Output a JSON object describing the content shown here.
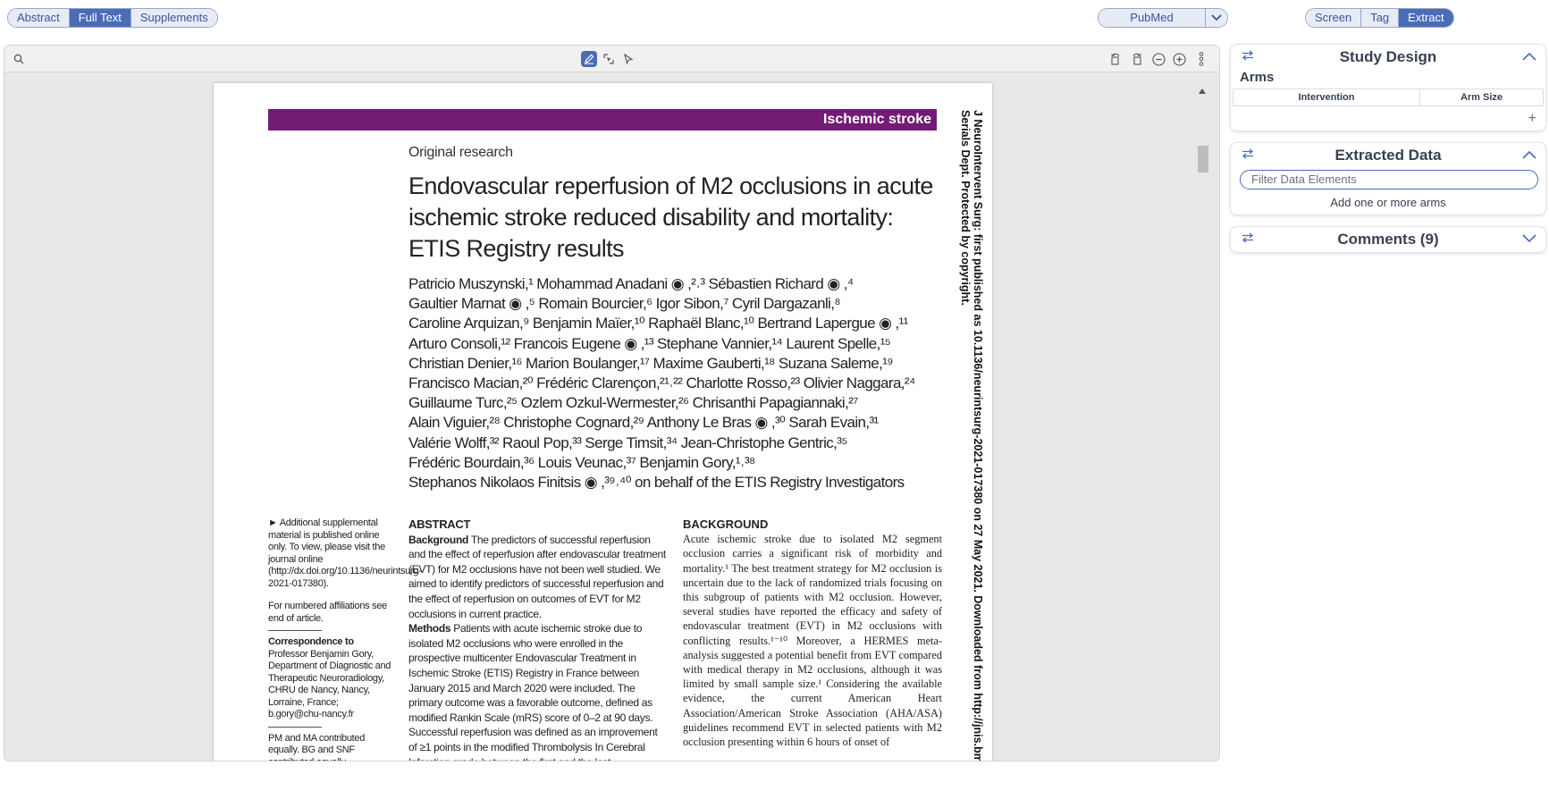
{
  "top_tabs": [
    "Abstract",
    "Full Text",
    "Supplements"
  ],
  "top_tabs_active": "Full Text",
  "pubmed": {
    "label": "PubMed"
  },
  "mode_tabs": [
    "Screen",
    "Tag",
    "Extract"
  ],
  "mode_tabs_active": "Extract",
  "document": {
    "banner": "Ischemic stroke",
    "section": "Original research",
    "title": "Endovascular reperfusion of M2 occlusions in acute ischemic stroke reduced disability and mortality: ETIS Registry results",
    "authors": [
      "Patricio Muszynski,¹ Mohammad Anadani ◉ ,²˒³ Sébastien Richard ◉ ,⁴",
      "Gaultier Marnat ◉ ,⁵ Romain Bourcier,⁶ Igor Sibon,⁷ Cyril Dargazanli,⁸",
      "Caroline Arquizan,⁹ Benjamin Maïer,¹⁰ Raphaël Blanc,¹⁰ Bertrand Lapergue ◉ ,¹¹",
      "Arturo Consoli,¹² Francois Eugene ◉ ,¹³ Stephane Vannier,¹⁴ Laurent Spelle,¹⁵",
      "Christian Denier,¹⁶ Marion Boulanger,¹⁷ Maxime Gauberti,¹⁸ Suzana Saleme,¹⁹",
      "Francisco Macian,²⁰ Frédéric Clarençon,²¹˒²² Charlotte Rosso,²³ Olivier Naggara,²⁴",
      "Guillaume Turc,²⁵ Ozlem Ozkul-Wermester,²⁶ Chrisanthi Papagiannaki,²⁷",
      "Alain Viguier,²⁸ Christophe Cognard,²⁹ Anthony Le Bras ◉ ,³⁰ Sarah Evain,³¹",
      "Valérie Wolff,³² Raoul Pop,³³ Serge Timsit,³⁴ Jean-Christophe Gentric,³⁵",
      "Frédéric Bourdain,³⁶ Louis Veunac,³⁷ Benjamin Gory,¹˒³⁸",
      "Stephanos Nikolaos Finitsis ◉ ,³⁹˒⁴⁰ on behalf of the ETIS Registry Investigators"
    ],
    "side_supp": "► Additional supplemental material is published online only. To view, please visit the journal online (http://dx.doi.org/10.1136/neurintsurg-2021-017380).",
    "side_affil": "For numbered affiliations see end of article.",
    "side_corr_head": "Correspondence to",
    "side_corr": "Professor Benjamin Gory, Department of Diagnostic and Therapeutic Neuroradiology, CHRU de Nancy, Nancy, Lorraine, France; b.gory@chu-nancy.fr",
    "side_contrib": "PM and MA contributed equally. BG and SNF contributed equally.",
    "abstract_head": "ABSTRACT",
    "abstract_bg_head": "Background",
    "abstract_bg": "The predictors of successful reperfusion and the effect of reperfusion after endovascular treatment (EVT) for M2 occlusions have not been well studied. We aimed to identify predictors of successful reperfusion and the effect of reperfusion on outcomes of EVT for M2 occlusions in current practice.",
    "abstract_methods_head": "Methods",
    "abstract_methods": "Patients with acute ischemic stroke due to isolated M2 occlusions who were enrolled in the prospective multicenter Endovascular Treatment in Ischemic Stroke (ETIS) Registry in France between January 2015 and March 2020 were included. The primary outcome was a favorable outcome, defined as modified Rankin Scale (mRS) score of 0–2 at 90 days. Successful reperfusion was defined as an improvement of ≥1 points in the modified Thrombolysis In Cerebral Infarction grade between the first and the last",
    "background_head": "BACKGROUND",
    "background_text": "Acute ischemic stroke due to isolated M2 segment occlusion carries a significant risk of morbidity and mortality.¹ The best treatment strategy for M2 occlusion is uncertain due to the lack of randomized trials focusing on this subgroup of patients with M2 occlusion. However, several studies have reported the efficacy and safety of endovascular treatment (EVT) in M2 occlusions with conflicting results.¹⁻¹⁰ Moreover, a HERMES meta-analysis suggested a potential benefit from EVT compared with medical therapy in M2 occlusions, although it was limited by small sample size.¹ Considering the available evidence, the current American Heart Association/American Stroke Association (AHA/ASA) guidelines recommend EVT in selected patients with M2 occlusion presenting within 6 hours of onset of",
    "rotated_line1": "J NeuroIntervent Surg: first published as 10.1136/neurintsurg-2021-017380 on 27 May 2021. Downloaded from http://jnis.bmj",
    "rotated_line2": "Serials Dept. Protected by copyright."
  },
  "panels": {
    "study_design": {
      "title": "Study Design",
      "arms_label": "Arms",
      "col1": "Intervention",
      "col2": "Arm Size",
      "add": "+"
    },
    "extracted": {
      "title": "Extracted Data",
      "filter_placeholder": "Filter Data Elements",
      "empty": "Add one or more arms"
    },
    "comments": {
      "title": "Comments (9)"
    }
  },
  "colors": {
    "accent": "#4b6cb7",
    "banner": "#731c75"
  }
}
